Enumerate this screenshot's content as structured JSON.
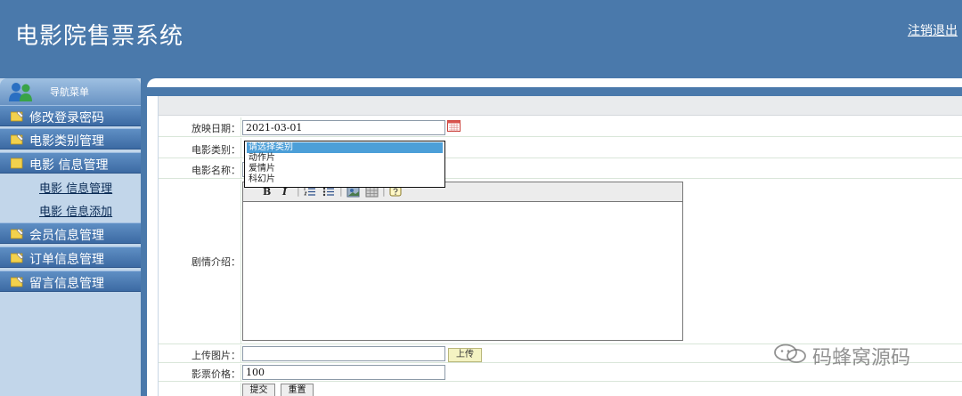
{
  "header": {
    "title": "电影院售票系统",
    "logout_label": "注销退出"
  },
  "sidebar": {
    "nav_title": "导航菜单",
    "items": [
      {
        "label": "修改登录密码",
        "icon": "folder-edit-icon",
        "expanded": false
      },
      {
        "label": "电影类别管理",
        "icon": "folder-edit-icon",
        "expanded": false
      },
      {
        "label": "电影 信息管理",
        "icon": "folder-icon",
        "expanded": true
      },
      {
        "label": "会员信息管理",
        "icon": "folder-edit-icon",
        "expanded": false
      },
      {
        "label": "订单信息管理",
        "icon": "folder-edit-icon",
        "expanded": false
      },
      {
        "label": "留言信息管理",
        "icon": "folder-edit-icon",
        "expanded": false
      }
    ],
    "subitems": [
      {
        "label": "电影 信息管理"
      },
      {
        "label": "电影 信息添加"
      }
    ]
  },
  "form": {
    "date_label": "放映日期：",
    "date_value": "2021-03-01",
    "type_label": "电影类别：",
    "type_options": [
      "请选择类别",
      "动作片",
      "爱情片",
      "科幻片"
    ],
    "type_selected": "请选择类别",
    "name_label": "电影名称：",
    "name_value": "",
    "plot_label": "剧情介绍：",
    "image_label": "上传图片：",
    "image_value": "",
    "upload_label": "上传",
    "price_label": "影票价格：",
    "price_value": "100",
    "submit_label": "提交",
    "reset_label": "重置"
  },
  "editor": {
    "tools": [
      "bold-icon",
      "italic-icon",
      "ordered-list-icon",
      "unordered-list-icon",
      "image-icon",
      "table-icon",
      "help-icon"
    ],
    "bold": "B",
    "italic": "I"
  },
  "watermark": {
    "text": "码蜂窝源码"
  },
  "colors": {
    "header_bg": "#4a79ab",
    "sidebar_bg": "#c2d6ea",
    "selected_option": "#4c9fd8"
  }
}
